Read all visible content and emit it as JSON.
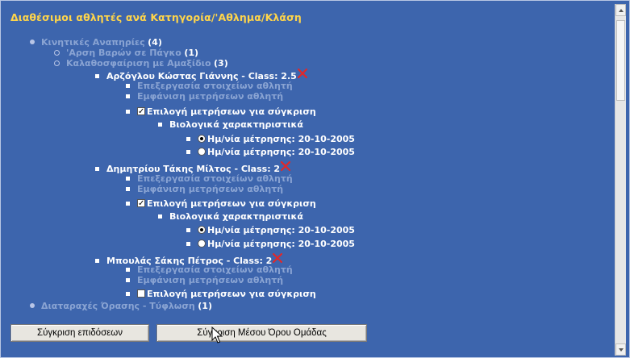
{
  "title": "Διαθέσιμοι αθλητές ανά Κατηγορία/'Αθλημα/Κλάση",
  "tree": {
    "category1": {
      "label": "Κινητικές Αναπηρίες",
      "count": "(4)"
    },
    "sport1": {
      "label": "'Αρση Βαρών σε Πάγκο",
      "count": "(1)"
    },
    "sport2": {
      "label": "Καλαθοσφαίριση με Αμαξίδιο",
      "count": "(3)"
    },
    "athletes": [
      {
        "name": "Αρζόγλου Κώστας Γιάννης - Class: 2.5",
        "edit": "Επεξεργασία στοιχείων αθλητή",
        "show": "Εμφάνιση μετρήσεων αθλητή",
        "compare": "Επιλογή μετρήσεων για σύγκριση",
        "compare_checked": true,
        "bio": "Βιολογικά χαρακτηριστικά",
        "dates": [
          "Ημ/νία μέτρησης: 20-10-2005",
          "Ημ/νία μέτρησης: 20-10-2005"
        ]
      },
      {
        "name": "Δημητρίου Τάκης Μίλτος - Class: 2",
        "edit": "Επεξεργασία στοιχείων αθλητή",
        "show": "Εμφάνιση μετρήσεων αθλητή",
        "compare": "Επιλογή μετρήσεων για σύγκριση",
        "compare_checked": true,
        "bio": "Βιολογικά χαρακτηριστικά",
        "dates": [
          "Ημ/νία μέτρησης: 20-10-2005",
          "Ημ/νία μέτρησης: 20-10-2005"
        ]
      },
      {
        "name": "Μπουλάς Σάκης Πέτρος - Class: 2",
        "edit": "Επεξεργασία στοιχείων αθλητή",
        "show": "Εμφάνιση μετρήσεων αθλητή",
        "compare": "Επιλογή μετρήσεων για σύγκριση",
        "compare_checked": false
      }
    ],
    "category2": {
      "label": "Διαταραχές Όρασης - Τύφλωση",
      "count": "(1)"
    }
  },
  "buttons": {
    "compare_performance": "Σύγκριση επιδόσεων",
    "compare_group_average": "Σύγκριση Μέσου Όρου Ομάδας"
  },
  "colors": {
    "background": "#3d65ad",
    "title": "#ffd54a",
    "link": "#8aa4d3",
    "text": "#ffffff",
    "delete_icon": "#e0282a"
  }
}
